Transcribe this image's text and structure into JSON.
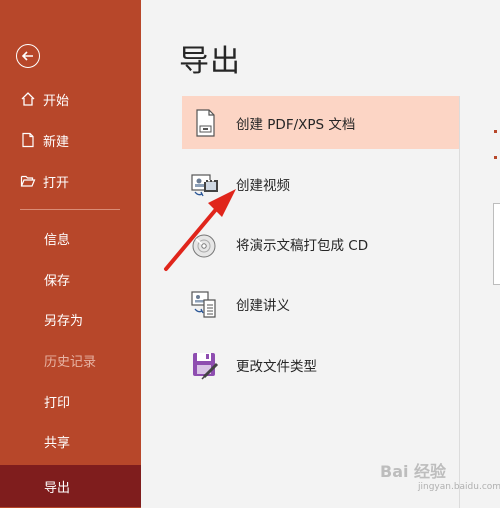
{
  "sidebar": {
    "back_label": "",
    "items": [
      {
        "label": "开始",
        "icon": "home-icon"
      },
      {
        "label": "新建",
        "icon": "new-file-icon"
      },
      {
        "label": "打开",
        "icon": "open-folder-icon"
      },
      {
        "label": "信息"
      },
      {
        "label": "保存"
      },
      {
        "label": "另存为"
      },
      {
        "label": "历史记录",
        "disabled": true
      },
      {
        "label": "打印"
      },
      {
        "label": "共享"
      },
      {
        "label": "导出",
        "active": true
      }
    ]
  },
  "main": {
    "title": "导出",
    "export_options": [
      {
        "label": "创建 PDF/XPS 文档",
        "icon": "pdf-document-icon",
        "selected": true
      },
      {
        "label": "创建视频",
        "icon": "video-icon"
      },
      {
        "label": "将演示文稿打包成 CD",
        "icon": "cd-package-icon"
      },
      {
        "label": "创建讲义",
        "icon": "handout-icon"
      },
      {
        "label": "更改文件类型",
        "icon": "change-file-type-icon"
      }
    ]
  },
  "watermark": {
    "text": "Bai 经验",
    "sub": "jingyan.baidu.com"
  },
  "colors": {
    "sidebar_bg": "#b7472a",
    "active_bg": "#7f1d1d",
    "selected_bg": "#fcd5c5",
    "arrow": "#e0251b"
  }
}
